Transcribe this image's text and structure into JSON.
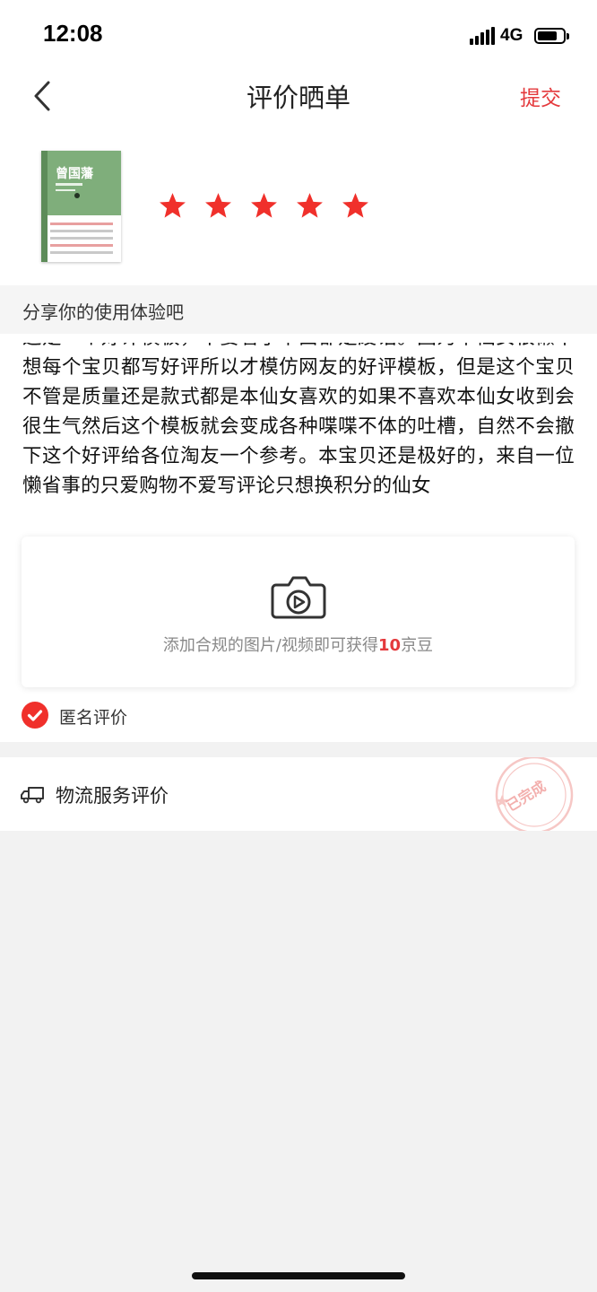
{
  "status_bar": {
    "time": "12:08",
    "network": "4G"
  },
  "nav": {
    "title": "评价晒单",
    "submit_label": "提交"
  },
  "product": {
    "cover_title": "曾国藩",
    "rating": 5,
    "star_color": "#f0302b"
  },
  "share_prompt": "分享你的使用体验吧",
  "review": {
    "text": "这是一个好评模板，不要看了下面都是废话。因为本仙女很懒不想每个宝贝都写好评所以才模仿网友的好评模板，但是这个宝贝不管是质量还是款式都是本仙女喜欢的如果不喜欢本仙女收到会很生气然后这个模板就会变成各种喋喋不体的吐槽，自然不会撤下这个好评给各位淘友一个参考。本宝贝还是极好的，来自一位懒省事的只爱购物不爱写评论只想换积分的仙女"
  },
  "upload": {
    "text_before": "添加合规的图片/视频即可获得",
    "highlight": "10",
    "text_after": "京豆"
  },
  "anonymous": {
    "label": "匿名评价",
    "checked": true
  },
  "logistics": {
    "label": "物流服务评价",
    "stamp": "已完成"
  },
  "colors": {
    "accent": "#e4393c",
    "background": "#f2f2f2"
  },
  "icons": {
    "back": "chevron-left-icon",
    "camera": "camera-video-icon",
    "check": "checkmark-circle-icon",
    "truck": "truck-icon"
  }
}
